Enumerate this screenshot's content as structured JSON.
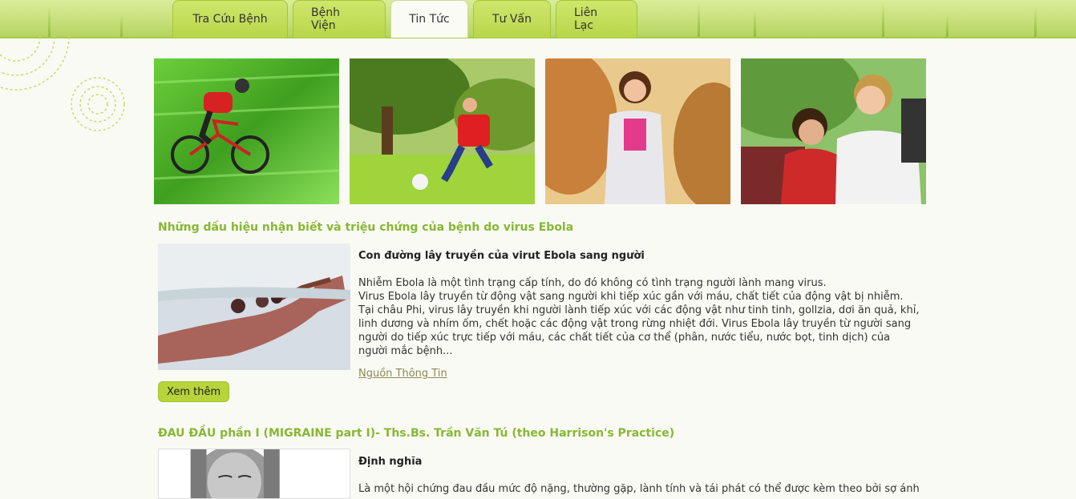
{
  "nav": {
    "tabs": [
      {
        "label": "Tra Cứu Bệnh"
      },
      {
        "label": "Bệnh Viện"
      },
      {
        "label": "Tin Tức"
      },
      {
        "label": "Tư Vấn"
      },
      {
        "label": "Liên Lạc"
      }
    ],
    "active_tab": "Tin Tức"
  },
  "colors": {
    "accent_green": "#86b833",
    "button_green": "#b7d43a",
    "header_green": "#c6e07a"
  },
  "photos": [
    {
      "icon": "cyclist-photo"
    },
    {
      "icon": "boy-kicking-ball-photo"
    },
    {
      "icon": "woman-jogging-photo"
    },
    {
      "icon": "hikers-photo"
    }
  ],
  "articles": [
    {
      "title": "Những dấu hiệu nhận biết và triệu chứng của bệnh do virus Ebola",
      "subtitle": "Con đường lây truyền của virut Ebola sang người",
      "body_line1": "Nhiễm Ebola là một tình trạng cấp tính, do đó không có tình trạng người lành mang virus.",
      "body_line2": "Virus Ebola lây truyền từ động vật sang người khi tiếp xúc gần với máu, chất tiết của động vật bị nhiễm. Tại châu Phi, virus lây truyền khi người lành tiếp xúc với các động vật như tinh tinh, gollzia, dơi ăn quả, khỉ, linh dương và nhím ốm, chết hoặc các động vật trong rừng nhiệt đới. Virus Ebola lây truyền từ người sang người do tiếp xúc trực tiếp với máu, các chất tiết của cơ thể (phân, nước tiểu, nước bọt, tinh dịch) của người mắc bệnh...",
      "source_link": "Nguồn Thông Tin",
      "more_button": "Xem thêm"
    },
    {
      "title": "ĐAU ĐẦU phần I (MIGRAINE part I)- Ths.Bs. Trần Văn Tú (theo Harrison's Practice)",
      "subtitle": "Định nghĩa",
      "body_line1": "Là một hội chứng đau đầu mức độ nặng, thường gặp, lành tính và tái phát có thể được kèm theo bởi sợ ánh"
    }
  ]
}
